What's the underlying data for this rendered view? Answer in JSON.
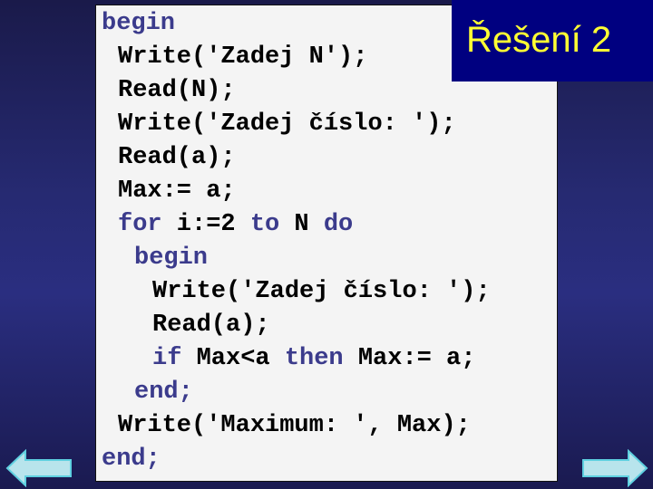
{
  "slide": {
    "title": "Řešení 2",
    "code_lines": [
      {
        "indent": 0,
        "parts": [
          {
            "t": "begin",
            "kw": true
          }
        ]
      },
      {
        "indent": 1,
        "parts": [
          {
            "t": "Write('Zadej N');",
            "kw": false
          }
        ]
      },
      {
        "indent": 1,
        "parts": [
          {
            "t": "Read(N);",
            "kw": false
          }
        ]
      },
      {
        "indent": 1,
        "parts": [
          {
            "t": "Write('Zadej číslo: ');",
            "kw": false
          }
        ]
      },
      {
        "indent": 1,
        "parts": [
          {
            "t": "Read(a);",
            "kw": false
          }
        ]
      },
      {
        "indent": 1,
        "parts": [
          {
            "t": "Max:= a;",
            "kw": false
          }
        ]
      },
      {
        "indent": 1,
        "parts": [
          {
            "t": "for",
            "kw": true
          },
          {
            "t": " i:=2 ",
            "kw": false
          },
          {
            "t": "to",
            "kw": true
          },
          {
            "t": " N ",
            "kw": false
          },
          {
            "t": "do",
            "kw": true
          }
        ]
      },
      {
        "indent": 2,
        "parts": [
          {
            "t": "begin",
            "kw": true
          }
        ]
      },
      {
        "indent": 3,
        "parts": [
          {
            "t": "Write('Zadej číslo: ');",
            "kw": false
          }
        ]
      },
      {
        "indent": 3,
        "parts": [
          {
            "t": "Read(a);",
            "kw": false
          }
        ]
      },
      {
        "indent": 3,
        "parts": [
          {
            "t": "if",
            "kw": true
          },
          {
            "t": " Max<a ",
            "kw": false
          },
          {
            "t": "then",
            "kw": true
          },
          {
            "t": " Max:= a;",
            "kw": false
          }
        ]
      },
      {
        "indent": 2,
        "parts": [
          {
            "t": "end;",
            "kw": true
          }
        ]
      },
      {
        "indent": 1,
        "parts": [
          {
            "t": "Write('Maximum: ', Max);",
            "kw": false
          }
        ]
      },
      {
        "indent": 0,
        "parts": [
          {
            "t": "end;",
            "kw": true
          }
        ]
      }
    ]
  },
  "navigation": {
    "back_icon": "arrow-left-icon",
    "forward_icon": "arrow-right-icon"
  },
  "colors": {
    "keyword": "#3b3b8c",
    "title_bg": "#000080",
    "title_text": "#ffff33",
    "arrow_fill": "#b8e4ec",
    "arrow_stroke": "#5fd0e0"
  }
}
